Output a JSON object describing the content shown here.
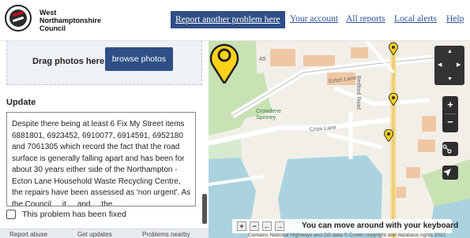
{
  "header": {
    "council_name": "West Northamptonshire Council",
    "nav": {
      "report_another": "Report another problem here",
      "your_account": "Your account",
      "all_reports": "All reports",
      "local_alerts": "Local alerts",
      "help": "Help"
    }
  },
  "upload": {
    "drag_text": "Drag photos here or",
    "browse_label": "browse photos"
  },
  "update": {
    "label": "Update",
    "text": "Despite there being at least 6 Fix My Street items 6881801, 6923452, 6910077, 6914591, 6952180 and 7061305 which record the fact that the road surface is generally falling apart and has been for about 30 years either side of the Northampton - Ecton Lane Household Waste Recycling Centre, the repairs have been assessed as 'non urgent'. As the Council ... it ... and ... the ..."
  },
  "fixed_checkbox": {
    "label": "This problem has been fixed",
    "checked": false
  },
  "bottom_tabs": {
    "report_abuse": "Report abuse",
    "get_updates": "Get updates",
    "problems_nearby": "Problems nearby"
  },
  "map": {
    "labels": {
      "bridge": "A5",
      "crowdene": "Crowdene Spinney",
      "road_a": "Ecton Lane",
      "road_b": "Crow Lane",
      "road_c": "Bedford Road"
    },
    "colors": {
      "pin": "#ffd21a",
      "water": "#aad3df",
      "woodland": "#c8e2b4",
      "road_yellow": "#f7dc8a",
      "building": "#f0c7a4"
    },
    "keyboard_hint": "You can move around with your keyboard",
    "credits": "Contains National Highways and OS data © Crown copyright and database rights 2022"
  }
}
